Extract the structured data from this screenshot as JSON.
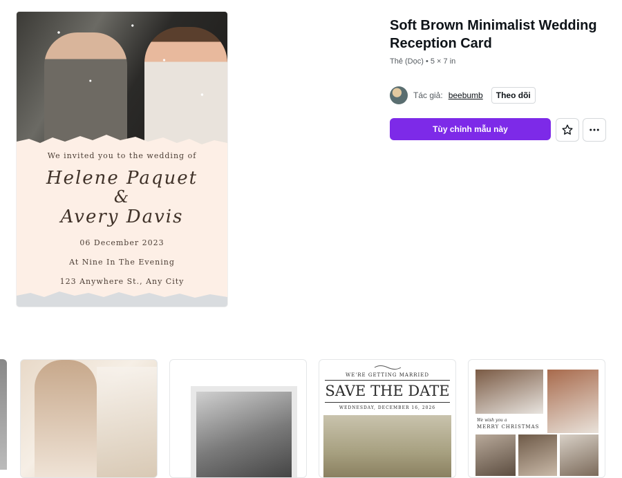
{
  "template": {
    "title": "Soft Brown Minimalist Wedding Reception Card",
    "meta": "Thẻ (Dọc) • 5 × 7 in",
    "author_prefix": "Tác giả:",
    "author_name": "beebumb",
    "follow_label": "Theo dõi",
    "customize_label": "Tùy chỉnh mẫu này",
    "accent_color": "#7d2ae8"
  },
  "preview": {
    "invite_line": "We invited you to the wedding of",
    "name1": "Helene Paquet",
    "ampersand": "&",
    "name2": "Avery Davis",
    "date": "06 December 2023",
    "time": "At Nine In The Evening",
    "address": "123 Anywhere St., Any City"
  },
  "thumbnails": {
    "t3_top": "WE'RE GETTING MARRIED",
    "t3_title": "SAVE THE DATE",
    "t3_date": "WEDNESDAY, DECEMBER 16, 2026",
    "t4_line1": "We wish you a",
    "t4_line2": "MERRY CHRISTMAS"
  },
  "icons": {
    "star": "star-icon",
    "more": "more-horizontal-icon"
  }
}
